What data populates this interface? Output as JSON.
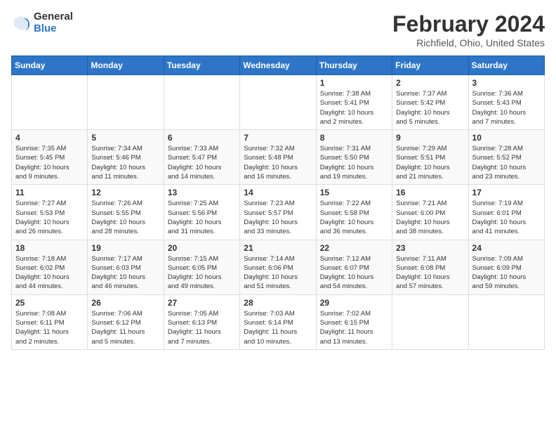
{
  "logo": {
    "general": "General",
    "blue": "Blue"
  },
  "title": "February 2024",
  "subtitle": "Richfield, Ohio, United States",
  "headers": [
    "Sunday",
    "Monday",
    "Tuesday",
    "Wednesday",
    "Thursday",
    "Friday",
    "Saturday"
  ],
  "weeks": [
    [
      {
        "day": "",
        "info": ""
      },
      {
        "day": "",
        "info": ""
      },
      {
        "day": "",
        "info": ""
      },
      {
        "day": "",
        "info": ""
      },
      {
        "day": "1",
        "info": "Sunrise: 7:38 AM\nSunset: 5:41 PM\nDaylight: 10 hours\nand 2 minutes."
      },
      {
        "day": "2",
        "info": "Sunrise: 7:37 AM\nSunset: 5:42 PM\nDaylight: 10 hours\nand 5 minutes."
      },
      {
        "day": "3",
        "info": "Sunrise: 7:36 AM\nSunset: 5:43 PM\nDaylight: 10 hours\nand 7 minutes."
      }
    ],
    [
      {
        "day": "4",
        "info": "Sunrise: 7:35 AM\nSunset: 5:45 PM\nDaylight: 10 hours\nand 9 minutes."
      },
      {
        "day": "5",
        "info": "Sunrise: 7:34 AM\nSunset: 5:46 PM\nDaylight: 10 hours\nand 11 minutes."
      },
      {
        "day": "6",
        "info": "Sunrise: 7:33 AM\nSunset: 5:47 PM\nDaylight: 10 hours\nand 14 minutes."
      },
      {
        "day": "7",
        "info": "Sunrise: 7:32 AM\nSunset: 5:48 PM\nDaylight: 10 hours\nand 16 minutes."
      },
      {
        "day": "8",
        "info": "Sunrise: 7:31 AM\nSunset: 5:50 PM\nDaylight: 10 hours\nand 19 minutes."
      },
      {
        "day": "9",
        "info": "Sunrise: 7:29 AM\nSunset: 5:51 PM\nDaylight: 10 hours\nand 21 minutes."
      },
      {
        "day": "10",
        "info": "Sunrise: 7:28 AM\nSunset: 5:52 PM\nDaylight: 10 hours\nand 23 minutes."
      }
    ],
    [
      {
        "day": "11",
        "info": "Sunrise: 7:27 AM\nSunset: 5:53 PM\nDaylight: 10 hours\nand 26 minutes."
      },
      {
        "day": "12",
        "info": "Sunrise: 7:26 AM\nSunset: 5:55 PM\nDaylight: 10 hours\nand 28 minutes."
      },
      {
        "day": "13",
        "info": "Sunrise: 7:25 AM\nSunset: 5:56 PM\nDaylight: 10 hours\nand 31 minutes."
      },
      {
        "day": "14",
        "info": "Sunrise: 7:23 AM\nSunset: 5:57 PM\nDaylight: 10 hours\nand 33 minutes."
      },
      {
        "day": "15",
        "info": "Sunrise: 7:22 AM\nSunset: 5:58 PM\nDaylight: 10 hours\nand 36 minutes."
      },
      {
        "day": "16",
        "info": "Sunrise: 7:21 AM\nSunset: 6:00 PM\nDaylight: 10 hours\nand 38 minutes."
      },
      {
        "day": "17",
        "info": "Sunrise: 7:19 AM\nSunset: 6:01 PM\nDaylight: 10 hours\nand 41 minutes."
      }
    ],
    [
      {
        "day": "18",
        "info": "Sunrise: 7:18 AM\nSunset: 6:02 PM\nDaylight: 10 hours\nand 44 minutes."
      },
      {
        "day": "19",
        "info": "Sunrise: 7:17 AM\nSunset: 6:03 PM\nDaylight: 10 hours\nand 46 minutes."
      },
      {
        "day": "20",
        "info": "Sunrise: 7:15 AM\nSunset: 6:05 PM\nDaylight: 10 hours\nand 49 minutes."
      },
      {
        "day": "21",
        "info": "Sunrise: 7:14 AM\nSunset: 6:06 PM\nDaylight: 10 hours\nand 51 minutes."
      },
      {
        "day": "22",
        "info": "Sunrise: 7:12 AM\nSunset: 6:07 PM\nDaylight: 10 hours\nand 54 minutes."
      },
      {
        "day": "23",
        "info": "Sunrise: 7:11 AM\nSunset: 6:08 PM\nDaylight: 10 hours\nand 57 minutes."
      },
      {
        "day": "24",
        "info": "Sunrise: 7:09 AM\nSunset: 6:09 PM\nDaylight: 10 hours\nand 59 minutes."
      }
    ],
    [
      {
        "day": "25",
        "info": "Sunrise: 7:08 AM\nSunset: 6:11 PM\nDaylight: 11 hours\nand 2 minutes."
      },
      {
        "day": "26",
        "info": "Sunrise: 7:06 AM\nSunset: 6:12 PM\nDaylight: 11 hours\nand 5 minutes."
      },
      {
        "day": "27",
        "info": "Sunrise: 7:05 AM\nSunset: 6:13 PM\nDaylight: 11 hours\nand 7 minutes."
      },
      {
        "day": "28",
        "info": "Sunrise: 7:03 AM\nSunset: 6:14 PM\nDaylight: 11 hours\nand 10 minutes."
      },
      {
        "day": "29",
        "info": "Sunrise: 7:02 AM\nSunset: 6:15 PM\nDaylight: 11 hours\nand 13 minutes."
      },
      {
        "day": "",
        "info": ""
      },
      {
        "day": "",
        "info": ""
      }
    ]
  ]
}
